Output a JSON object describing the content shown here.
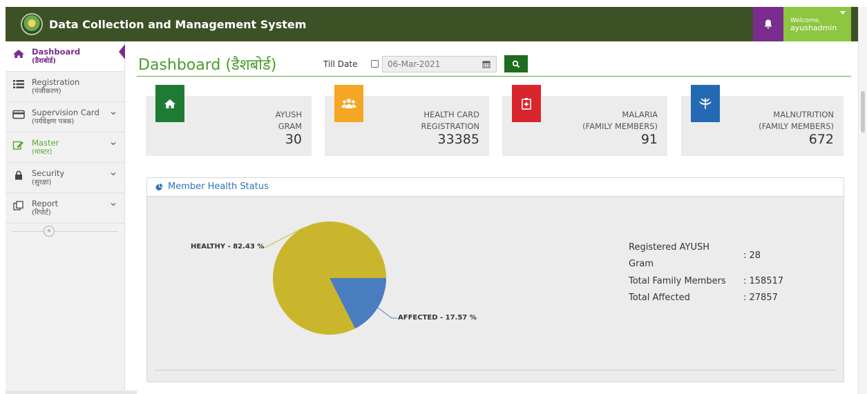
{
  "app": {
    "title": "Data Collection and Management System"
  },
  "user": {
    "welcome": "Welcome,",
    "username": "ayushadmin"
  },
  "sidebar": {
    "items": [
      {
        "label": "Dashboard",
        "sub": "(डैशबोर्ड)",
        "icon": "home-icon",
        "active": true
      },
      {
        "label": "Registration",
        "sub": "(पंजीकरण)",
        "icon": "list-icon"
      },
      {
        "label": "Supervision Card",
        "sub": "(पर्यवेक्षण पत्रक)",
        "icon": "card-icon"
      },
      {
        "label": "Master",
        "sub": "(मास्टर)",
        "icon": "edit-icon"
      },
      {
        "label": "Security",
        "sub": "(सुरक्षा)",
        "icon": "lock-icon"
      },
      {
        "label": "Report",
        "sub": "(रिपोर्ट)",
        "icon": "report-icon"
      }
    ],
    "collapse_glyph": "«"
  },
  "header": {
    "page_title": "Dashboard (डैशबोर्ड)",
    "till_date_label": "Till Date",
    "date_value": "06-Mar-2021"
  },
  "cards": [
    {
      "label1": "AYUSH",
      "label2": "GRAM",
      "value": "30",
      "color": "#1e7b34",
      "icon": "home-icon"
    },
    {
      "label1": "HEALTH CARD",
      "label2": "REGISTRATION",
      "value": "33385",
      "color": "#f5a623",
      "icon": "users-icon"
    },
    {
      "label1": "MALARIA",
      "label2": "(FAMILY MEMBERS)",
      "value": "91",
      "color": "#d9262c",
      "icon": "hospital-icon"
    },
    {
      "label1": "MALNUTRITION",
      "label2": "(FAMILY MEMBERS)",
      "value": "672",
      "color": "#2469b3",
      "icon": "leaf-icon"
    }
  ],
  "panel": {
    "title": "Member Health Status",
    "stats": [
      {
        "key1": "Registered AYUSH",
        "key2": "Gram",
        "value": ": 28"
      },
      {
        "key1": "Total Family Members",
        "value": ": 158517"
      },
      {
        "key1": "Total Affected",
        "value": ": 27857"
      }
    ]
  },
  "chart_data": {
    "type": "pie",
    "slices": [
      {
        "name": "HEALTHY - 82.43 %",
        "value": 82.43,
        "color": "#c9b62c"
      },
      {
        "name": "AFFECTED - 17.57 %",
        "value": 17.57,
        "color": "#4a7cc0"
      }
    ]
  }
}
